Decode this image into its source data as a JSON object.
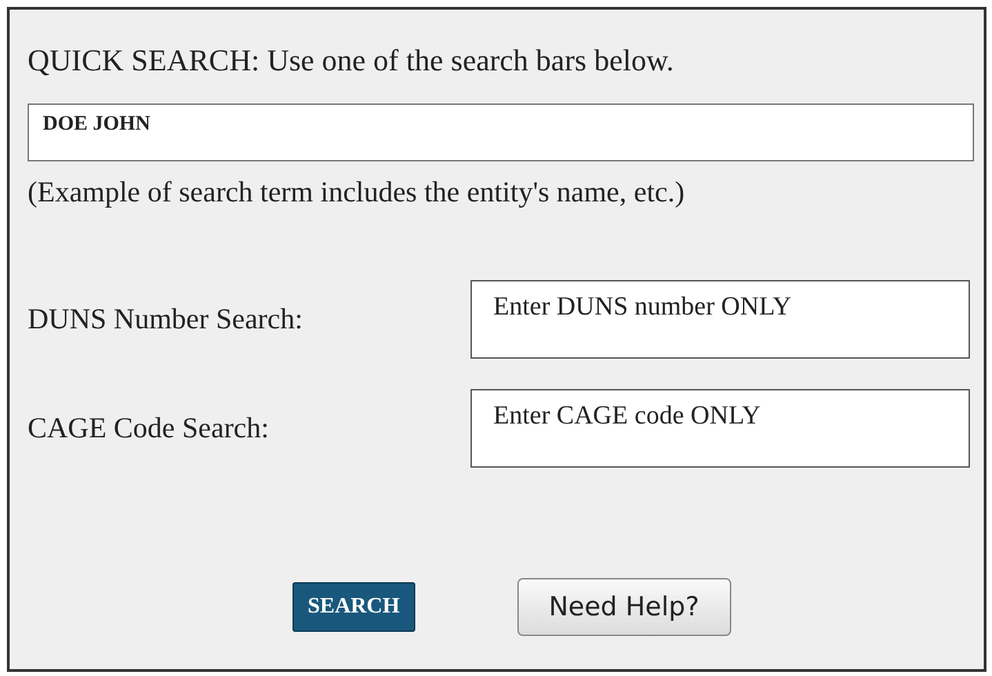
{
  "title": "QUICK SEARCH: Use one of the search bars below.",
  "quick_search": {
    "value": "DOE JOHN"
  },
  "hint": "(Example of search term includes the entity's name, etc.)",
  "fields": [
    {
      "label": "DUNS Number Search:",
      "placeholder": "Enter DUNS number ONLY"
    },
    {
      "label": "CAGE Code Search:",
      "placeholder": "Enter CAGE code ONLY"
    }
  ],
  "buttons": [
    {
      "kind": "primary",
      "label": "SEARCH"
    },
    {
      "kind": "secondary",
      "label": "Need Help?"
    }
  ]
}
